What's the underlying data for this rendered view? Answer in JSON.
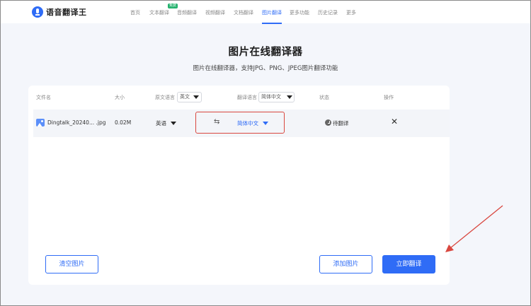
{
  "app": {
    "name": "语音翻译王"
  },
  "nav": {
    "items": [
      "首页",
      "文本翻译",
      "音频翻译",
      "视频翻译",
      "文档翻译",
      "图片翻译",
      "更多功能",
      "历史记录",
      "更多"
    ],
    "badge": "免费",
    "active": "图片翻译"
  },
  "hero": {
    "title": "图片在线翻译器",
    "subtitle": "图片在线翻译器，支持JPG、PNG、JPEG图片翻译功能"
  },
  "table": {
    "headers": {
      "filename": "文件名",
      "size": "大小",
      "source_lang": "原文语言",
      "target_lang": "翻译语言",
      "status": "状态",
      "action": "操作"
    },
    "source_select_value": "英文",
    "target_select_value": "简体中文",
    "rows": [
      {
        "filename": "Dingtalk_20240... .jpg",
        "size": "0.02M",
        "source": "英语",
        "target": "简体中文",
        "status": "待翻译"
      }
    ]
  },
  "buttons": {
    "clear": "清空图片",
    "add": "添加图片",
    "translate": "立即翻译"
  },
  "colors": {
    "accent": "#2f6cf6",
    "highlight_border": "#d9473f",
    "badge": "#23b26d"
  }
}
